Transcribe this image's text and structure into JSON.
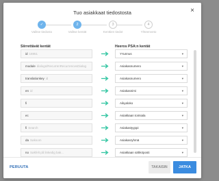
{
  "dialog": {
    "title": "Tuo asiakkaat tiedostosta",
    "close_label": "×"
  },
  "stepper": {
    "steps": [
      {
        "number": "✓",
        "label": "Valitse tiedosto",
        "state": "done"
      },
      {
        "number": "2",
        "label": "Valitse kentät",
        "state": "active"
      },
      {
        "number": "3",
        "label": "Kenttien tiedot",
        "state": "todo"
      },
      {
        "number": "4",
        "label": "Yhteenveto",
        "state": "todo"
      }
    ]
  },
  "columns": {
    "source": "Siirrettävät kentät",
    "target": "Heeros PSA:n kentät"
  },
  "rows": [
    {
      "source_key": "id",
      "source_value": "16951",
      "target": "Y-tunnus"
    },
    {
      "source_key": "module",
      "source_value": "dialogs/RecurrenRecurrencesDialog",
      "target": "Asiakasnumero"
    },
    {
      "source_key": "translationkey",
      "source_value": "id",
      "target": "Asiakasnumero"
    },
    {
      "source_key": "en",
      "source_value": "id",
      "target": "Asiakasnimi"
    },
    {
      "source_key": "fi",
      "source_value": "",
      "target": "Aikyaloko"
    },
    {
      "source_key": "ec",
      "source_value": "",
      "target": "Asiakkaan toimiala"
    },
    {
      "source_key": "fi",
      "source_value": "Search",
      "target": "Asiakastyyppi"
    },
    {
      "source_key": "da",
      "source_value": "Søksom",
      "target": "Asiakasryhmä"
    },
    {
      "source_key": "no",
      "source_value": "Søkfelt på linkedig bak...",
      "target": "Asiakkaan sähköposti"
    }
  ],
  "footer": {
    "cancel": "PERUUTA",
    "back": "TAKAISIN",
    "next": "JATKA"
  },
  "colors": {
    "primary": "#3b8ce0",
    "arrow": "#2ec4a0",
    "step_active": "#6fb4ec"
  }
}
